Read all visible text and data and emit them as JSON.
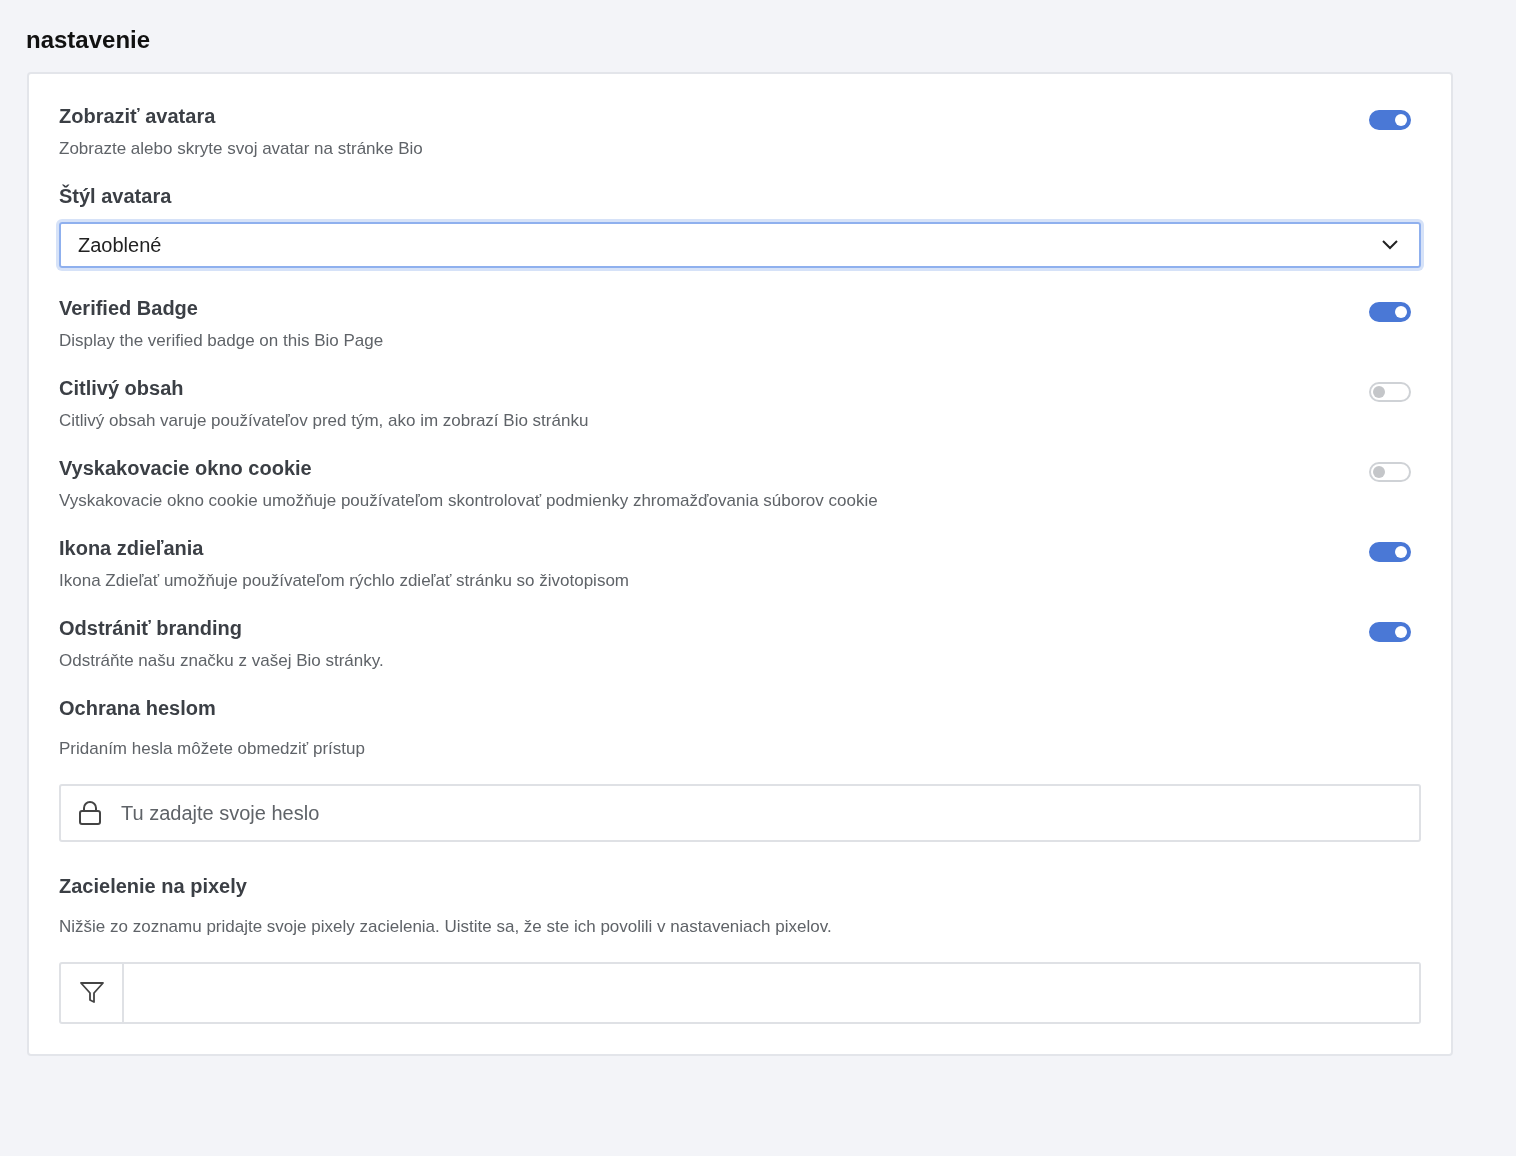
{
  "page_title": "nastavenie",
  "items": [
    {
      "kind": "toggle",
      "title": "Zobraziť avatara",
      "description": "Zobrazte alebo skryte svoj avatar na stránke Bio",
      "on": true
    },
    {
      "kind": "select",
      "title": "Štýl avatara",
      "value": "Zaoblené"
    },
    {
      "kind": "toggle",
      "title": "Verified Badge",
      "description": "Display the verified badge on this Bio Page",
      "on": true
    },
    {
      "kind": "toggle",
      "title": "Citlivý obsah",
      "description": "Citlivý obsah varuje používateľov pred tým, ako im zobrazí Bio stránku",
      "on": false
    },
    {
      "kind": "toggle",
      "title": "Vyskakovacie okno cookie",
      "description": "Vyskakovacie okno cookie umožňuje používateľom skontrolovať podmienky zhromažďovania súborov cookie",
      "on": false
    },
    {
      "kind": "toggle",
      "title": "Ikona zdieľania",
      "description": "Ikona Zdieľať umožňuje používateľom rýchlo zdieľať stránku so životopisom",
      "on": true
    },
    {
      "kind": "toggle",
      "title": "Odstrániť branding",
      "description": "Odstráňte našu značku z vašej Bio stránky.",
      "on": true
    }
  ],
  "password": {
    "title": "Ochrana heslom",
    "description": "Pridaním hesla môžete obmedziť prístup",
    "placeholder": "Tu zadajte svoje heslo"
  },
  "pixels": {
    "title": "Zacielenie na pixely",
    "description": "Nižšie zo zoznamu pridajte svoje pixely zacielenia. Uistite sa, že ste ich povolili v nastaveniach pixelov."
  }
}
